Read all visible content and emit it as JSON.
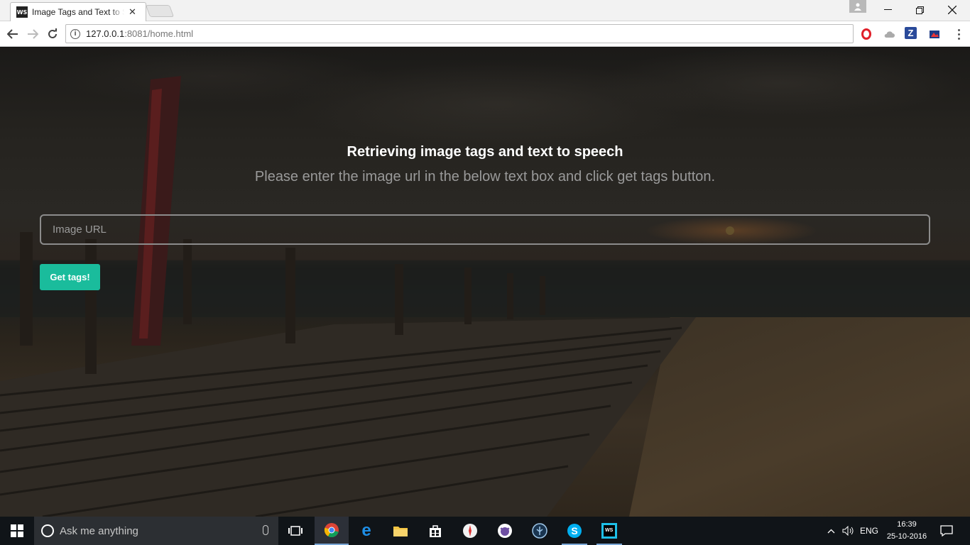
{
  "browser": {
    "tab_title": "Image Tags and Text to Speech",
    "tab_favicon": "WS",
    "url_host": "127.0.0.1",
    "url_rest": ":8081/home.html"
  },
  "page": {
    "heading": "Retrieving image tags and text to speech",
    "subheading": "Please enter the image url in the below text box and click get tags button.",
    "input_placeholder": "Image URL",
    "button_label": "Get tags!",
    "accent_color": "#1abc9c"
  },
  "taskbar": {
    "search_placeholder": "Ask me anything",
    "language": "ENG",
    "time": "16:39",
    "date": "25-10-2016"
  }
}
